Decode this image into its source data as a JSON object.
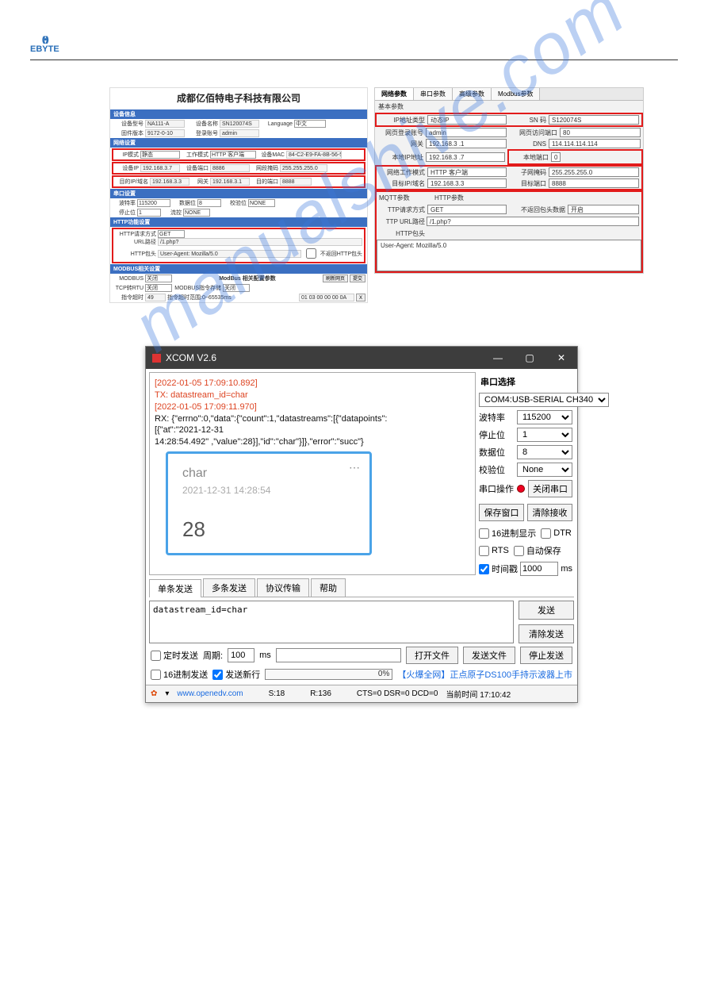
{
  "logo": {
    "brand": "EBYTE"
  },
  "watermark": "manualshive.com",
  "cfg": {
    "title": "成都亿佰特电子科技有限公司",
    "sec_device": "设备信息",
    "dev": {
      "model_l": "设备型号",
      "model": "NA111-A",
      "fw_l": "固件版本",
      "fw": "9172-0-10",
      "name_l": "设备名称",
      "name": "SN120074S",
      "lang_l": "Language",
      "lang": "中文",
      "login_l": "登录账号",
      "login": "admin"
    },
    "sec_net": "网络设置",
    "net": {
      "ipmode_l": "IP模式",
      "ipmode": "静态",
      "work_l": "工作模式",
      "work": "HTTP 客户端",
      "mac_l": "设备MAC",
      "mac": "84-C2-E9-FA-8B-56-56",
      "devip_l": "设备IP",
      "devip": "192.168.3.7",
      "devport_l": "设备端口",
      "devport": "8886",
      "subnet_l": "网段掩码",
      "subnet": "255.255.255.0",
      "gw_l": "网关",
      "gw": "192.168.3.1",
      "dstip_l": "目的IP/域名",
      "dstip": "192.168.3.3",
      "dstport_l": "目的端口",
      "dstport": "8888"
    },
    "sec_serial": "串口设置",
    "serial": {
      "baud_l": "波特率",
      "baud": "115200",
      "data_l": "数据位",
      "data": "8",
      "parity_l": "校验位",
      "parity": "NONE",
      "stop_l": "停止位",
      "stop": "1",
      "flow_l": "流控",
      "flow": "NONE"
    },
    "sec_http": "HTTP功能设置",
    "http": {
      "method_l": "HTTP请求方式",
      "method": "GET",
      "url_l": "URL路径",
      "url": "/1.php?",
      "hdr_l": "HTTP包头",
      "hdr": "User-Agent: Mozilla/5.0",
      "noret_l": "不返回HTTP包头"
    },
    "sec_modbus": "MODBUS相关设置",
    "modbus": {
      "en_l": "MODBUS",
      "en_opt": "关闭",
      "tcprtu_l": "TCP转RTU",
      "tcprtu_opt": "关闭",
      "cache_l": "MODBUS指令存储",
      "cache_opt": "关闭",
      "title": "ModBus 相关配置参数",
      "timeout_l": "指令超时",
      "timeout": "49",
      "store_l": "指令超时范围:0~65535ms",
      "addr": "01 03 00 00 00 0A",
      "x": "X",
      "refresh": "刷新网页",
      "save": "提交"
    }
  },
  "netp": {
    "tabs": {
      "a": "网络参数",
      "b": "串口参数",
      "c": "高级参数",
      "d": "Modbus参数"
    },
    "basic_title": "基本参数",
    "ipmode_l": "IP地址类型",
    "ipmode": "动态IP",
    "sn_l": "SN 码",
    "sn": "S120074S",
    "web_l": "网页登录账号",
    "web": "admin",
    "webport_l": "网页访问端口",
    "webport": "80",
    "gw_l": "网关",
    "gw": "192.168.3  .1",
    "dns_l": "DNS",
    "dns": "114.114.114.114",
    "local_l": "本地IP地址",
    "local": "192.168.3  .7",
    "lport_l": "本地端口",
    "lport": "0",
    "mode_l": "网络工作模式",
    "mode": "HTTP 客户端",
    "mask_l": "子网掩码",
    "mask": "255.255.255.0",
    "dst_l": "目标IP/域名",
    "dst": "192.168.3.3",
    "dport_l": "目标端口",
    "dport": "8888",
    "mqtt_l": "MQTT参数",
    "http_l": "HTTP参数",
    "method_l": "TTP请求方式",
    "method": "GET",
    "noret_l": "不返回包头数据",
    "noret": "开启",
    "url_l": "TTP URL路径",
    "url": "/1.php?",
    "hdr_l": "HTTP包头",
    "hdr_body": "User-Agent: Mozilla/5.0"
  },
  "xcom": {
    "title": "XCOM V2.6",
    "log": {
      "ts1": "[2022-01-05 17:09:10.892]",
      "tx": "TX: datastream_id=char",
      "ts2": "[2022-01-05 17:09:11.970]",
      "rx1": "RX: {\"errno\":0,\"data\":{\"count\":1,\"datastreams\":[{\"datapoints\":",
      "rx2": "[{\"at\":\"2021-12-31",
      "rx3": "14:28:54.492\"  ,\"value\":28}],\"id\":\"char\"}]},\"error\":\"succ\"}"
    },
    "card": {
      "name": "char",
      "time": "2021-12-31 14:28:54",
      "value": "28"
    },
    "side": {
      "title": "串口选择",
      "port": "COM4:USB-SERIAL CH340",
      "baud_l": "波特率",
      "baud": "115200",
      "stop_l": "停止位",
      "stop": "1",
      "data_l": "数据位",
      "data": "8",
      "parity_l": "校验位",
      "parity": "None",
      "op_l": "串口操作",
      "op_btn": "关闭串口",
      "save": "保存窗口",
      "clear": "清除接收",
      "hex": "16进制显示",
      "dtr": "DTR",
      "rts": "RTS",
      "auto": "自动保存",
      "tstamp": "时间戳",
      "tval": "1000",
      "ms": "ms"
    },
    "sendtabs": {
      "a": "单条发送",
      "b": "多条发送",
      "c": "协议传输",
      "d": "帮助"
    },
    "sendbox": "datastream_id=char",
    "send": "发送",
    "clrsend": "清除发送",
    "opt": {
      "timed": "定时发送",
      "period_l": "周期:",
      "period": "100",
      "ms": "ms",
      "open": "打开文件",
      "sendf": "发送文件",
      "stop": "停止发送",
      "hexsend": "16进制发送",
      "newline": "发送新行",
      "pct": "0%",
      "ad": "【火爆全网】正点原子DS100手持示波器上市"
    },
    "status": {
      "url": "www.openedv.com",
      "s": "S:18",
      "r": "R:136",
      "line": "CTS=0 DSR=0 DCD=0",
      "time_l": "当前时间",
      "time": "17:10:42"
    }
  }
}
